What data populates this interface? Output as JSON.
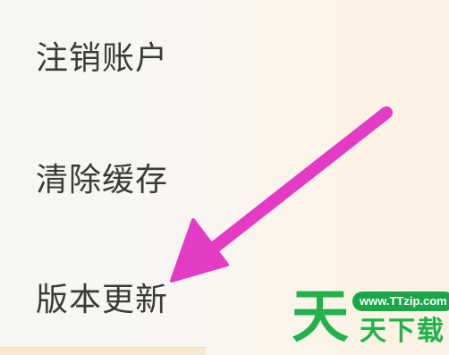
{
  "settings": {
    "items": [
      {
        "label": "注销账户"
      },
      {
        "label": "清除缓存"
      },
      {
        "label": "版本更新"
      }
    ]
  },
  "annotation": {
    "type": "arrow",
    "color": "#e33bc4",
    "points_to": "版本更新"
  },
  "watermark": {
    "logo_char": "天",
    "url": "www.TTzip.com",
    "name": "天下载",
    "color": "#21b24b"
  }
}
